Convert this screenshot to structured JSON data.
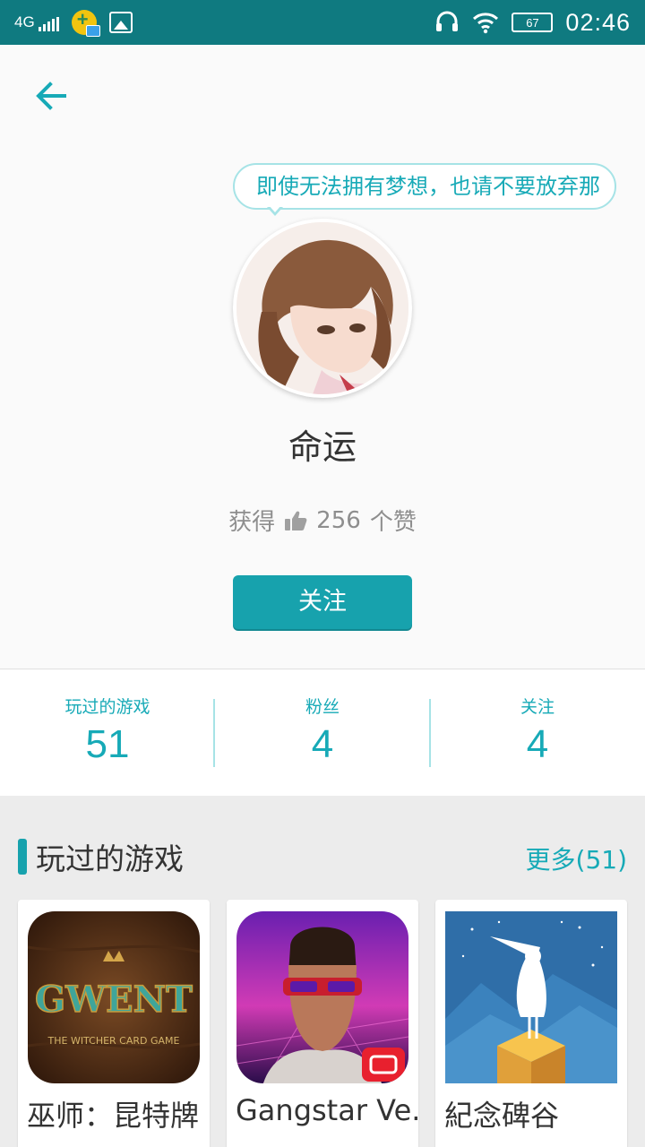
{
  "status_bar": {
    "network": "4G",
    "time": "02:46",
    "battery": "67"
  },
  "profile": {
    "signature": "即使无法拥有梦想，也请不要放弃那",
    "username": "命运",
    "likes_prefix": "获得",
    "likes_count": "256",
    "likes_suffix": "个赞",
    "follow_button": "关注"
  },
  "stats": [
    {
      "label": "玩过的游戏",
      "value": "51"
    },
    {
      "label": "粉丝",
      "value": "4"
    },
    {
      "label": "关注",
      "value": "4"
    }
  ],
  "played_section": {
    "title": "玩过的游戏",
    "more": "更多(51)",
    "games": [
      {
        "name": "巫师：昆特牌",
        "cover_text": "GWENT",
        "cover_subtext": "THE WITCHER CARD GAME"
      },
      {
        "name": "Gangstar Ve..."
      },
      {
        "name": "紀念碑谷"
      }
    ]
  },
  "colors": {
    "accent": "#17a2ad",
    "status_bar": "#0f7a80"
  }
}
